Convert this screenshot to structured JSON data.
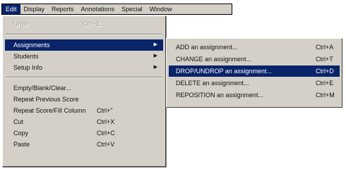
{
  "menubar": {
    "items": [
      {
        "label": "Edit",
        "active": true
      },
      {
        "label": "Display"
      },
      {
        "label": "Reports"
      },
      {
        "label": "Annotations"
      },
      {
        "label": "Special"
      },
      {
        "label": "Window"
      }
    ]
  },
  "edit_menu": {
    "undo": {
      "label": "Undo",
      "shortcut": "Ctrl+Z"
    },
    "assignments": {
      "label": "Assignments"
    },
    "students": {
      "label": "Students"
    },
    "setup_info": {
      "label": "Setup Info"
    },
    "empty": {
      "label": "Empty/Blank/Clear..."
    },
    "repeat_prev": {
      "label": "Repeat Previous Score"
    },
    "repeat_fill": {
      "label": "Repeat Score/Fill Column",
      "shortcut": "Ctrl+\""
    },
    "cut": {
      "label": "Cut",
      "shortcut": "Ctrl+X"
    },
    "copy": {
      "label": "Copy",
      "shortcut": "Ctrl+C"
    },
    "paste": {
      "label": "Paste",
      "shortcut": "Ctrl+V"
    }
  },
  "assignments_submenu": {
    "add": {
      "label": "ADD an assignment...",
      "shortcut": "Ctrl+A"
    },
    "change": {
      "label": "CHANGE an assignment...",
      "shortcut": "Ctrl+T"
    },
    "drop": {
      "label": "DROP/UNDROP an assignment...",
      "shortcut": "Ctrl+D"
    },
    "delete": {
      "label": "DELETE an assignment...",
      "shortcut": "Ctrl+E"
    },
    "reposition": {
      "label": "REPOSITION an assignment...",
      "shortcut": "Ctrl+M"
    }
  },
  "icons": {
    "submenu_arrow": "triangle-right-icon"
  },
  "colors": {
    "menu_bg": "#d4d0c8",
    "highlight": "#0a246a"
  }
}
